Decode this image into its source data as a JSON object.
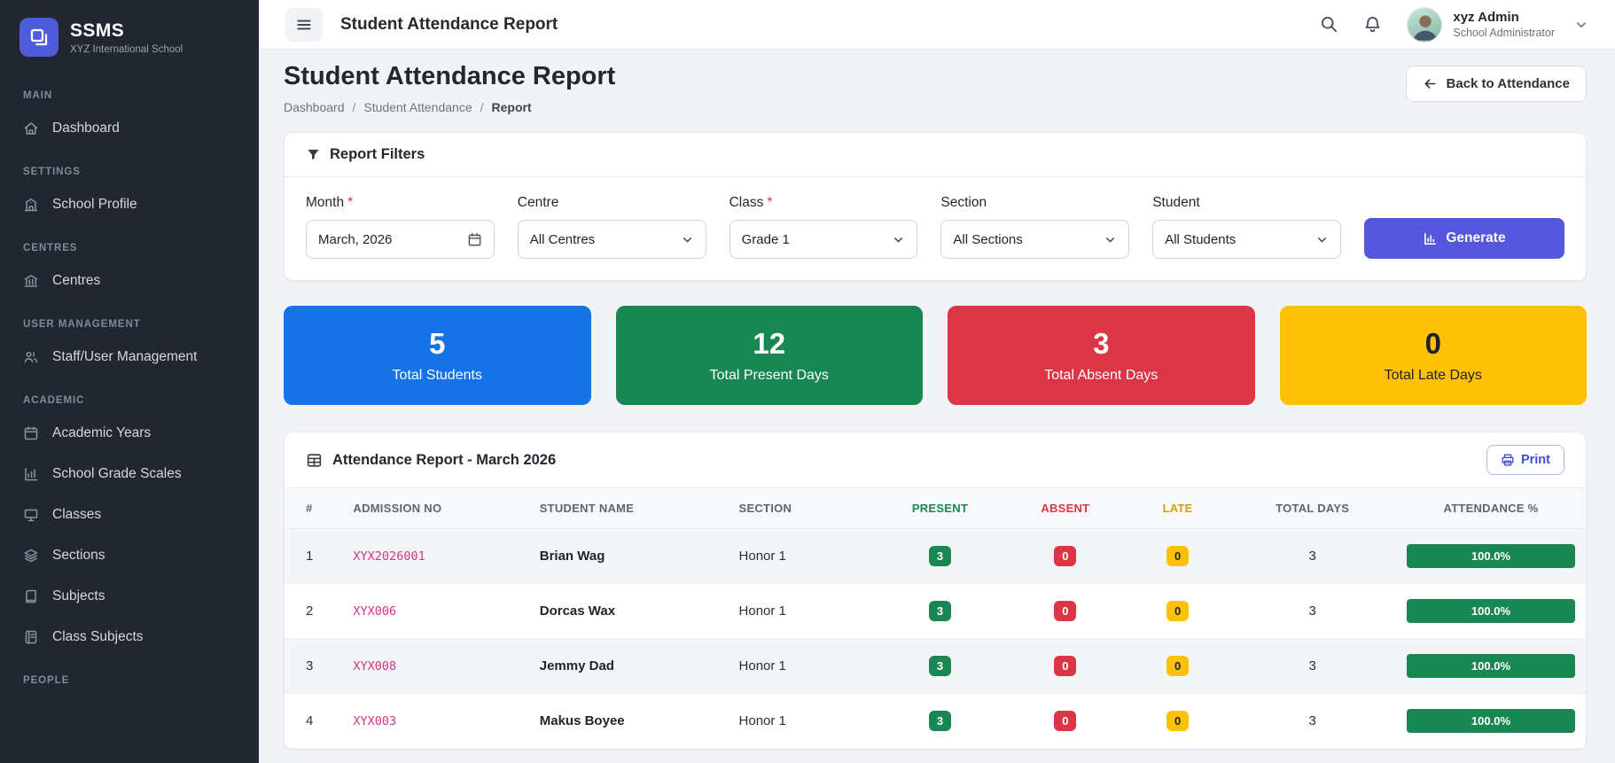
{
  "colors": {
    "sidebar_bg": "#212631",
    "accent_indigo": "#5558dd",
    "primary_blue": "#1673e6",
    "success_green": "#198754",
    "danger_red": "#dc3545",
    "warning_yellow": "#ffc107",
    "link_pink": "#d63384"
  },
  "sidebar": {
    "logo": {
      "title": "SSMS",
      "subtitle": "XYZ International School",
      "icon": "app-logo-icon"
    },
    "sections": [
      {
        "label": "MAIN",
        "items": [
          {
            "label": "Dashboard",
            "icon": "home-icon"
          }
        ]
      },
      {
        "label": "SETTINGS",
        "items": [
          {
            "label": "School Profile",
            "icon": "school-building-icon"
          }
        ]
      },
      {
        "label": "CENTRES",
        "items": [
          {
            "label": "Centres",
            "icon": "bank-icon"
          }
        ]
      },
      {
        "label": "USER MANAGEMENT",
        "items": [
          {
            "label": "Staff/User Management",
            "icon": "users-icon"
          }
        ]
      },
      {
        "label": "ACADEMIC",
        "items": [
          {
            "label": "Academic Years",
            "icon": "calendar-icon"
          },
          {
            "label": "School Grade Scales",
            "icon": "bar-chart-icon"
          },
          {
            "label": "Classes",
            "icon": "monitor-icon"
          },
          {
            "label": "Sections",
            "icon": "layers-icon"
          },
          {
            "label": "Subjects",
            "icon": "book-icon"
          },
          {
            "label": "Class Subjects",
            "icon": "journal-icon"
          }
        ]
      },
      {
        "label": "PEOPLE",
        "items": []
      }
    ]
  },
  "header": {
    "title": "Student Attendance Report",
    "icons": [
      "menu-icon",
      "search-icon",
      "bell-icon"
    ],
    "user": {
      "name": "xyz Admin",
      "role": "School Administrator"
    }
  },
  "page": {
    "title": "Student Attendance Report",
    "breadcrumb": [
      "Dashboard",
      "Student Attendance",
      "Report"
    ],
    "back_button_label": "Back to Attendance"
  },
  "filters": {
    "title": "Report Filters",
    "fields": [
      {
        "label": "Month",
        "required": true,
        "value": "March, 2026",
        "type": "month-picker",
        "icon": "calendar-icon"
      },
      {
        "label": "Centre",
        "required": false,
        "value": "All Centres",
        "type": "select",
        "icon": "chevron-down-icon"
      },
      {
        "label": "Class",
        "required": true,
        "value": "Grade 1",
        "type": "select",
        "icon": "chevron-down-icon"
      },
      {
        "label": "Section",
        "required": false,
        "value": "All Sections",
        "type": "select",
        "icon": "chevron-down-icon"
      },
      {
        "label": "Student",
        "required": false,
        "value": "All Students",
        "type": "select",
        "icon": "chevron-down-icon"
      }
    ],
    "generate_label": "Generate"
  },
  "stats": [
    {
      "value": "5",
      "label": "Total Students",
      "color": "#1673e6"
    },
    {
      "value": "12",
      "label": "Total Present Days",
      "color": "#198754"
    },
    {
      "value": "3",
      "label": "Total Absent Days",
      "color": "#dc3545"
    },
    {
      "value": "0",
      "label": "Total Late Days",
      "color": "#ffc107"
    }
  ],
  "report": {
    "title": "Attendance Report - March 2026",
    "print_label": "Print",
    "table": {
      "headers": [
        "#",
        "ADMISSION NO",
        "STUDENT NAME",
        "SECTION",
        "PRESENT",
        "ABSENT",
        "LATE",
        "TOTAL DAYS",
        "ATTENDANCE %"
      ],
      "rows": [
        {
          "num": "1",
          "admission_no": "XYX2026001",
          "name": "Brian Wag",
          "section": "Honor 1",
          "present": "3",
          "absent": "0",
          "late": "0",
          "total_days": "3",
          "attendance": "100.0%"
        },
        {
          "num": "2",
          "admission_no": "XYX006",
          "name": "Dorcas Wax",
          "section": "Honor 1",
          "present": "3",
          "absent": "0",
          "late": "0",
          "total_days": "3",
          "attendance": "100.0%"
        },
        {
          "num": "3",
          "admission_no": "XYX008",
          "name": "Jemmy Dad",
          "section": "Honor 1",
          "present": "3",
          "absent": "0",
          "late": "0",
          "total_days": "3",
          "attendance": "100.0%"
        },
        {
          "num": "4",
          "admission_no": "XYX003",
          "name": "Makus Boyee",
          "section": "Honor 1",
          "present": "3",
          "absent": "0",
          "late": "0",
          "total_days": "3",
          "attendance": "100.0%"
        }
      ]
    }
  }
}
